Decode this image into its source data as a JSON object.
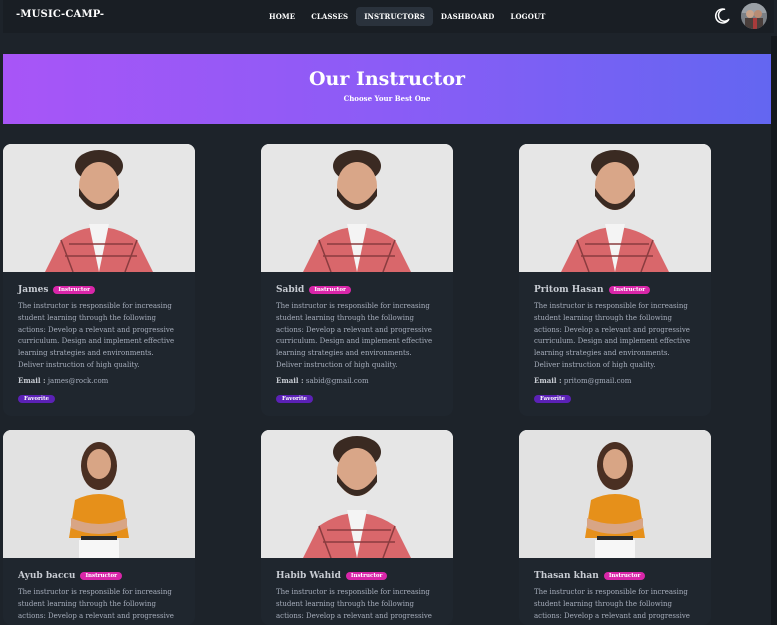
{
  "navbar": {
    "brand": "-MUSIC-CAMP-",
    "links": [
      {
        "label": "HOME"
      },
      {
        "label": "CLASSES"
      },
      {
        "label": "INSTRUCTORS"
      },
      {
        "label": "DASHBOARD"
      },
      {
        "label": "LOGOUT"
      }
    ],
    "active_link": "INSTRUCTORS"
  },
  "banner": {
    "title": "Our Instructor",
    "subtitle": "Choose Your Best One",
    "gradient_colors": [
      "#a855f7",
      "#6366f1"
    ]
  },
  "instructors": [
    {
      "name": "James",
      "badge": "Instructor",
      "description": "The instructor is responsible for increasing student learning through the following actions: Develop a relevant and progressive curriculum. Design and implement effective learning strategies and environments. Deliver instruction of high quality.",
      "email_label": "Email :",
      "email": "james@rock.com",
      "favorite": "Favorite",
      "photo": "man"
    },
    {
      "name": "Sabid",
      "badge": "Instructor",
      "description": "The instructor is responsible for increasing student learning through the following actions: Develop a relevant and progressive curriculum. Design and implement effective learning strategies and environments. Deliver instruction of high quality.",
      "email_label": "Email :",
      "email": "sabid@gmail.com",
      "favorite": "Favorite",
      "photo": "man"
    },
    {
      "name": "Pritom Hasan",
      "badge": "Instructor",
      "description": "The instructor is responsible for increasing student learning through the following actions: Develop a relevant and progressive curriculum. Design and implement effective learning strategies and environments. Deliver instruction of high quality.",
      "email_label": "Email :",
      "email": "pritom@gmail.com",
      "favorite": "Favorite",
      "photo": "man"
    },
    {
      "name": "Ayub baccu",
      "badge": "Instructor",
      "description": "The instructor is responsible for increasing student learning through the following actions: Develop a relevant and progressive",
      "photo": "woman"
    },
    {
      "name": "Habib Wahid",
      "badge": "Instructor",
      "description": "The instructor is responsible for increasing student learning through the following actions: Develop a relevant and progressive",
      "photo": "man"
    },
    {
      "name": "Thasan khan",
      "badge": "Instructor",
      "description": "The instructor is responsible for increasing student learning through the following actions: Develop a relevant and progressive",
      "photo": "woman"
    }
  ],
  "colors": {
    "background": "#1d232a",
    "navbar": "#191e24",
    "badge": "#d926a9",
    "favorite": "#5b21b6"
  }
}
